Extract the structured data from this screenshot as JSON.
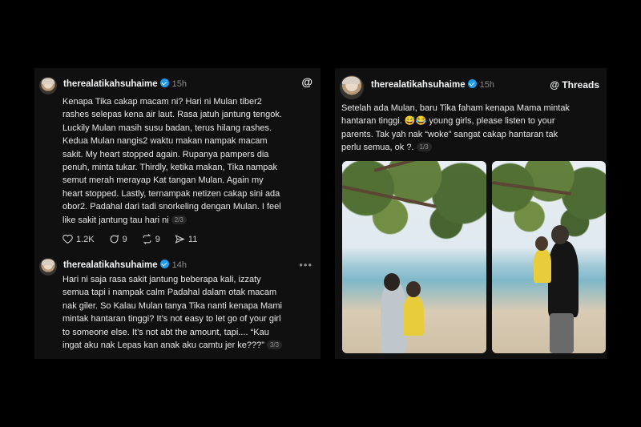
{
  "left_card": {
    "post1": {
      "username": "therealatikahsuhaime",
      "time": "15h",
      "lines": [
        "Kenapa Tika cakap macam ni? Hari ni Mulan tiber2",
        "rashes selepas kena air laut. Rasa jatuh jantung tengok.",
        "Luckily Mulan masih susu badan, terus hilang rashes.",
        "Kedua Mulan nangis2 waktu makan nampak macam",
        "sakit. My heart stopped again. Rupanya pampers dia",
        "penuh, minta tukar. Thirdly, ketika makan, Tika nampak",
        "semut merah merayap Kat tangan Mulan. Again my",
        "heart stopped. Lastly, ternampak netizen cakap sini ada",
        "obor2. Padahal dari tadi snorkeling dengan Mulan. I feel",
        "like sakit jantung tau hari ni"
      ],
      "pager": "2/3",
      "likes": "1.2K",
      "comments": "9",
      "reposts": "9",
      "shares": "11"
    },
    "post2": {
      "username": "therealatikahsuhaime",
      "time": "14h",
      "more": "•••",
      "lines": [
        "Hari ni saja rasa sakit jantung beberapa kali, izzaty",
        "semua tapi i nampak calm Padahal dalam otak macam",
        "nak giler. So Kalau Mulan tanya Tika nanti kenapa Mami",
        "mintak hantaran tinggi? It’s not easy to let go of your girl",
        "to someone else. It’s not abt the amount, tapi.... “Kau",
        "ingat aku nak Lepas kan anak aku camtu jer ke???”"
      ],
      "pager": "3/3"
    }
  },
  "right_card": {
    "username": "therealatikahsuhaime",
    "time": "15h",
    "brand": "Threads",
    "lines": [
      "Setelah ada Mulan, baru Tika faham kenapa Mama mintak",
      "hantaran tinggi. 😅😂 young girls, please listen to your",
      "parents. Tak yah nak “woke” sangat cakap hantaran tak",
      "perlu semua, ok ?."
    ],
    "pager": "1/3"
  },
  "colors": {
    "background": "#000000",
    "card": "#101010",
    "text": "#f3f5f7",
    "muted": "#8a8a8a",
    "verified": "#1d9bf0"
  }
}
